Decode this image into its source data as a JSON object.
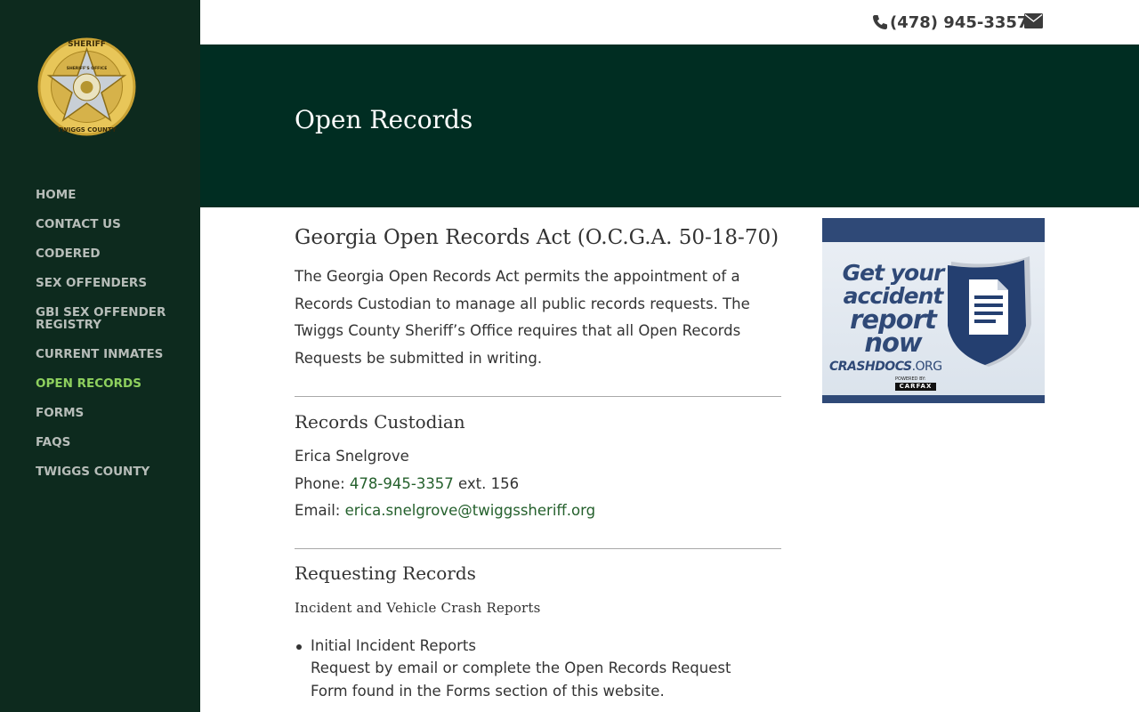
{
  "site": {
    "phone": "(478) 945-3357",
    "colors": {
      "sidebar": "#0d2a1e",
      "banner": "#002d22",
      "accent_nav": "#8ed05e",
      "link": "#24602c"
    }
  },
  "logo": {
    "top_text": "SHERIFF",
    "bottom_text": "TWIGGS COUNTY",
    "center_text": "SHERIFF'S OFFICE"
  },
  "nav": {
    "items": [
      {
        "label": "HOME"
      },
      {
        "label": "CONTACT US"
      },
      {
        "label": "CODERED"
      },
      {
        "label": "SEX OFFENDERS"
      },
      {
        "label": "GBI SEX OFFENDER REGISTRY"
      },
      {
        "label": "CURRENT INMATES"
      },
      {
        "label": "OPEN RECORDS",
        "active": true
      },
      {
        "label": "FORMS"
      },
      {
        "label": "FAQS"
      },
      {
        "label": "TWIGGS COUNTY"
      }
    ]
  },
  "banner": {
    "title": "Open Records"
  },
  "content": {
    "heading": "Georgia Open Records Act (O.C.G.A. 50-18-70)",
    "intro": "The Georgia Open Records Act permits the appointment of a Records Custodian to manage all public records requests. The Twiggs County Sheriff’s Office requires that all Open Records Requests be submitted in writing.",
    "custodian": {
      "heading": "Records Custodian",
      "name": "Erica Snelgrove",
      "phone_label": "Phone: ",
      "phone": "478-945-3357",
      "ext": " ext. 156",
      "email_label": "Email: ",
      "email": "erica.snelgrove@twiggssheriff.org"
    },
    "requesting": {
      "heading": "Requesting Records",
      "subheading": "Incident and Vehicle Crash Reports",
      "items": [
        {
          "title": "Initial Incident Reports",
          "text": "Request by email or complete the Open Records Request Form found in the Forms section of this website."
        }
      ]
    }
  },
  "ad": {
    "line1": "Get your",
    "line2": "accident",
    "line3": "report",
    "line4": "now",
    "brand_bold": "CRASHDOCS",
    "brand_light": ".ORG",
    "powered": "POWERED BY:",
    "carfax": "CARFAX"
  }
}
